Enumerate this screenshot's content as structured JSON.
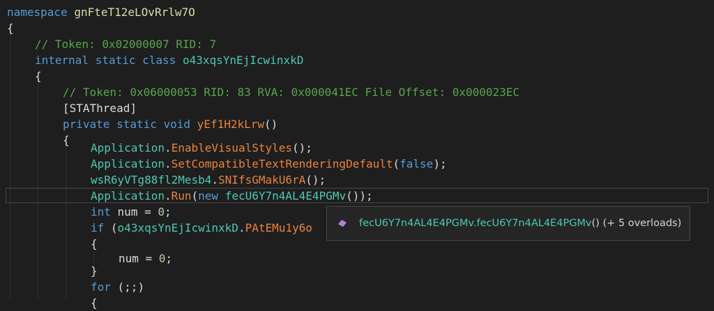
{
  "code": {
    "namespace_kw": "namespace",
    "namespace_name": "gnFteT12eLOvRrlw7O",
    "open_brace": "{",
    "close_brace": "}",
    "comment_class": "// Token: 0x02000007 RID: 7",
    "class_modifiers": "internal static class",
    "class_name": "o43xqsYnEjIcwinxkD",
    "comment_method": "// Token: 0x06000053 RID: 83 RVA: 0x000041EC File Offset: 0x000023EC",
    "attribute": "[STAThread]",
    "method_modifiers": "private static void",
    "method_name": "yEf1H2kLrw",
    "method_parens": "()",
    "app_class": "Application",
    "dot": ".",
    "call_visual": "EnableVisualStyles",
    "call_compat": "SetCompatibleTextRenderingDefault",
    "false_kw": "false",
    "other_class": "wsR6yVTg88fl2Mesb4",
    "call_snif": "SNIfsGMakU6rA",
    "call_run": "Run",
    "new_kw": "new",
    "form_class": "fecU6Y7n4AL4E4PGMv",
    "int_kw": "int",
    "num_decl": "num = ",
    "zero": "0",
    "if_kw": "if",
    "if_class": "o43xqsYnEjIcwinxkD",
    "if_member": "PAtEMu1y6o",
    "num_assign": "num = ",
    "for_kw": "for",
    "for_body": " (;;)",
    "paren_call_end": "();",
    "paren_close": ");",
    "run_close": "());",
    "semi": ";"
  },
  "tooltip": {
    "icon": "method-cube-icon",
    "class_part": "fecU6Y7n4AL4E4PGMv",
    "method_part": ".fecU6Y7n4AL4E4PGMv",
    "params": "()",
    "overloads": " (+ 5 overloads)"
  },
  "colors": {
    "background": "#1e1e1e",
    "keyword": "#569cd6",
    "comment": "#57a64a",
    "namespace": "#dcdcaa",
    "class": "#4ec9b0",
    "method": "#e8843c",
    "number": "#b5cea8",
    "text": "#dcdcdc"
  }
}
